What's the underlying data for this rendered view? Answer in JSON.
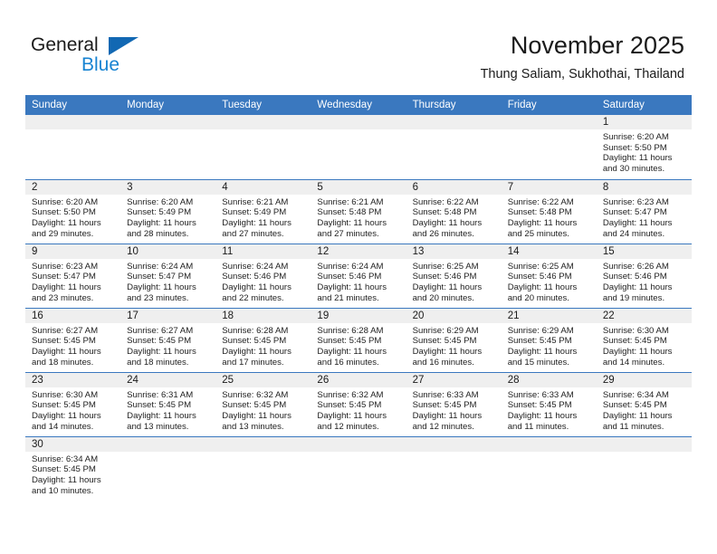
{
  "brand": {
    "line1": "General",
    "line2": "Blue",
    "flag_icon": "blue-triangle-flag",
    "color_dark": "#1b1b1b",
    "color_blue": "#1783d2"
  },
  "header": {
    "title": "November 2025",
    "subtitle": "Thung Saliam, Sukhothai, Thailand",
    "header_bg": "#3a78bf",
    "band_bg": "#efefef"
  },
  "weekdays": [
    "Sunday",
    "Monday",
    "Tuesday",
    "Wednesday",
    "Thursday",
    "Friday",
    "Saturday"
  ],
  "weeks": [
    [
      {
        "day": "",
        "empty": true
      },
      {
        "day": "",
        "empty": true
      },
      {
        "day": "",
        "empty": true
      },
      {
        "day": "",
        "empty": true
      },
      {
        "day": "",
        "empty": true
      },
      {
        "day": "",
        "empty": true
      },
      {
        "day": "1",
        "sunrise": "Sunrise: 6:20 AM",
        "sunset": "Sunset: 5:50 PM",
        "daylight1": "Daylight: 11 hours",
        "daylight2": "and 30 minutes."
      }
    ],
    [
      {
        "day": "2",
        "sunrise": "Sunrise: 6:20 AM",
        "sunset": "Sunset: 5:50 PM",
        "daylight1": "Daylight: 11 hours",
        "daylight2": "and 29 minutes."
      },
      {
        "day": "3",
        "sunrise": "Sunrise: 6:20 AM",
        "sunset": "Sunset: 5:49 PM",
        "daylight1": "Daylight: 11 hours",
        "daylight2": "and 28 minutes."
      },
      {
        "day": "4",
        "sunrise": "Sunrise: 6:21 AM",
        "sunset": "Sunset: 5:49 PM",
        "daylight1": "Daylight: 11 hours",
        "daylight2": "and 27 minutes."
      },
      {
        "day": "5",
        "sunrise": "Sunrise: 6:21 AM",
        "sunset": "Sunset: 5:48 PM",
        "daylight1": "Daylight: 11 hours",
        "daylight2": "and 27 minutes."
      },
      {
        "day": "6",
        "sunrise": "Sunrise: 6:22 AM",
        "sunset": "Sunset: 5:48 PM",
        "daylight1": "Daylight: 11 hours",
        "daylight2": "and 26 minutes."
      },
      {
        "day": "7",
        "sunrise": "Sunrise: 6:22 AM",
        "sunset": "Sunset: 5:48 PM",
        "daylight1": "Daylight: 11 hours",
        "daylight2": "and 25 minutes."
      },
      {
        "day": "8",
        "sunrise": "Sunrise: 6:23 AM",
        "sunset": "Sunset: 5:47 PM",
        "daylight1": "Daylight: 11 hours",
        "daylight2": "and 24 minutes."
      }
    ],
    [
      {
        "day": "9",
        "sunrise": "Sunrise: 6:23 AM",
        "sunset": "Sunset: 5:47 PM",
        "daylight1": "Daylight: 11 hours",
        "daylight2": "and 23 minutes."
      },
      {
        "day": "10",
        "sunrise": "Sunrise: 6:24 AM",
        "sunset": "Sunset: 5:47 PM",
        "daylight1": "Daylight: 11 hours",
        "daylight2": "and 23 minutes."
      },
      {
        "day": "11",
        "sunrise": "Sunrise: 6:24 AM",
        "sunset": "Sunset: 5:46 PM",
        "daylight1": "Daylight: 11 hours",
        "daylight2": "and 22 minutes."
      },
      {
        "day": "12",
        "sunrise": "Sunrise: 6:24 AM",
        "sunset": "Sunset: 5:46 PM",
        "daylight1": "Daylight: 11 hours",
        "daylight2": "and 21 minutes."
      },
      {
        "day": "13",
        "sunrise": "Sunrise: 6:25 AM",
        "sunset": "Sunset: 5:46 PM",
        "daylight1": "Daylight: 11 hours",
        "daylight2": "and 20 minutes."
      },
      {
        "day": "14",
        "sunrise": "Sunrise: 6:25 AM",
        "sunset": "Sunset: 5:46 PM",
        "daylight1": "Daylight: 11 hours",
        "daylight2": "and 20 minutes."
      },
      {
        "day": "15",
        "sunrise": "Sunrise: 6:26 AM",
        "sunset": "Sunset: 5:46 PM",
        "daylight1": "Daylight: 11 hours",
        "daylight2": "and 19 minutes."
      }
    ],
    [
      {
        "day": "16",
        "sunrise": "Sunrise: 6:27 AM",
        "sunset": "Sunset: 5:45 PM",
        "daylight1": "Daylight: 11 hours",
        "daylight2": "and 18 minutes."
      },
      {
        "day": "17",
        "sunrise": "Sunrise: 6:27 AM",
        "sunset": "Sunset: 5:45 PM",
        "daylight1": "Daylight: 11 hours",
        "daylight2": "and 18 minutes."
      },
      {
        "day": "18",
        "sunrise": "Sunrise: 6:28 AM",
        "sunset": "Sunset: 5:45 PM",
        "daylight1": "Daylight: 11 hours",
        "daylight2": "and 17 minutes."
      },
      {
        "day": "19",
        "sunrise": "Sunrise: 6:28 AM",
        "sunset": "Sunset: 5:45 PM",
        "daylight1": "Daylight: 11 hours",
        "daylight2": "and 16 minutes."
      },
      {
        "day": "20",
        "sunrise": "Sunrise: 6:29 AM",
        "sunset": "Sunset: 5:45 PM",
        "daylight1": "Daylight: 11 hours",
        "daylight2": "and 16 minutes."
      },
      {
        "day": "21",
        "sunrise": "Sunrise: 6:29 AM",
        "sunset": "Sunset: 5:45 PM",
        "daylight1": "Daylight: 11 hours",
        "daylight2": "and 15 minutes."
      },
      {
        "day": "22",
        "sunrise": "Sunrise: 6:30 AM",
        "sunset": "Sunset: 5:45 PM",
        "daylight1": "Daylight: 11 hours",
        "daylight2": "and 14 minutes."
      }
    ],
    [
      {
        "day": "23",
        "sunrise": "Sunrise: 6:30 AM",
        "sunset": "Sunset: 5:45 PM",
        "daylight1": "Daylight: 11 hours",
        "daylight2": "and 14 minutes."
      },
      {
        "day": "24",
        "sunrise": "Sunrise: 6:31 AM",
        "sunset": "Sunset: 5:45 PM",
        "daylight1": "Daylight: 11 hours",
        "daylight2": "and 13 minutes."
      },
      {
        "day": "25",
        "sunrise": "Sunrise: 6:32 AM",
        "sunset": "Sunset: 5:45 PM",
        "daylight1": "Daylight: 11 hours",
        "daylight2": "and 13 minutes."
      },
      {
        "day": "26",
        "sunrise": "Sunrise: 6:32 AM",
        "sunset": "Sunset: 5:45 PM",
        "daylight1": "Daylight: 11 hours",
        "daylight2": "and 12 minutes."
      },
      {
        "day": "27",
        "sunrise": "Sunrise: 6:33 AM",
        "sunset": "Sunset: 5:45 PM",
        "daylight1": "Daylight: 11 hours",
        "daylight2": "and 12 minutes."
      },
      {
        "day": "28",
        "sunrise": "Sunrise: 6:33 AM",
        "sunset": "Sunset: 5:45 PM",
        "daylight1": "Daylight: 11 hours",
        "daylight2": "and 11 minutes."
      },
      {
        "day": "29",
        "sunrise": "Sunrise: 6:34 AM",
        "sunset": "Sunset: 5:45 PM",
        "daylight1": "Daylight: 11 hours",
        "daylight2": "and 11 minutes."
      }
    ],
    [
      {
        "day": "30",
        "sunrise": "Sunrise: 6:34 AM",
        "sunset": "Sunset: 5:45 PM",
        "daylight1": "Daylight: 11 hours",
        "daylight2": "and 10 minutes."
      },
      {
        "day": "",
        "empty": true
      },
      {
        "day": "",
        "empty": true
      },
      {
        "day": "",
        "empty": true
      },
      {
        "day": "",
        "empty": true
      },
      {
        "day": "",
        "empty": true
      },
      {
        "day": "",
        "empty": true
      }
    ]
  ]
}
